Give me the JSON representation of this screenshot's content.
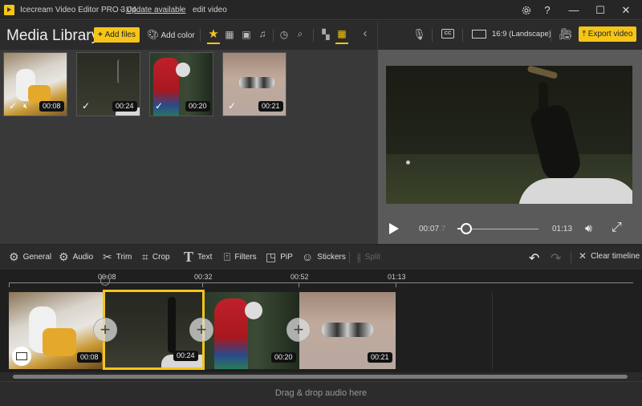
{
  "titlebar": {
    "app_title": "Icecream Video Editor PRO 3.04",
    "separator": "-",
    "update_link": "Update available",
    "separator2": "-",
    "project_name": "edit video",
    "settings_icon": "gear-icon",
    "help_label": "?",
    "minimize_label": "—",
    "maximize_label": "☐",
    "close_label": "✕"
  },
  "library": {
    "title": "Media Library",
    "add_files_label": "Add files",
    "add_color_label": "Add color",
    "filters": [
      "all-star-icon",
      "video-icon",
      "image-icon",
      "music-icon"
    ],
    "items": [
      {
        "duration": "00:08",
        "checked": true,
        "muted": true
      },
      {
        "duration": "00:24",
        "checked": true,
        "muted": false
      },
      {
        "duration": "00:20",
        "checked": true,
        "muted": false
      },
      {
        "duration": "00:21",
        "checked": true,
        "muted": false
      }
    ]
  },
  "preview_toolbar": {
    "aspect_label": "16:9 (Landscape)",
    "export_label": "Export video"
  },
  "player": {
    "current_time": "00:07",
    "current_fraction": ".7",
    "total_time": "01:13",
    "progress_fraction": 0.105
  },
  "edit_toolbar": {
    "general": "General",
    "audio": "Audio",
    "trim": "Trim",
    "crop": "Crop",
    "text": "Text",
    "filters": "Filters",
    "pip": "PiP",
    "stickers": "Stickers",
    "split": "Split",
    "clear_timeline": "Clear timeline"
  },
  "timeline": {
    "ticks": [
      "00:08",
      "00:32",
      "00:52",
      "01:13"
    ],
    "clips": [
      {
        "duration": "00:08",
        "selected": false
      },
      {
        "duration": "00:24",
        "selected": true
      },
      {
        "duration": "00:20",
        "selected": false
      },
      {
        "duration": "00:21",
        "selected": false
      }
    ]
  },
  "audio_track": {
    "placeholder": "Drag & drop audio here"
  },
  "colors": {
    "accent": "#f5c518",
    "background": "#262626",
    "library_bg": "#393939",
    "preview_bg": "#5a5a5a"
  }
}
